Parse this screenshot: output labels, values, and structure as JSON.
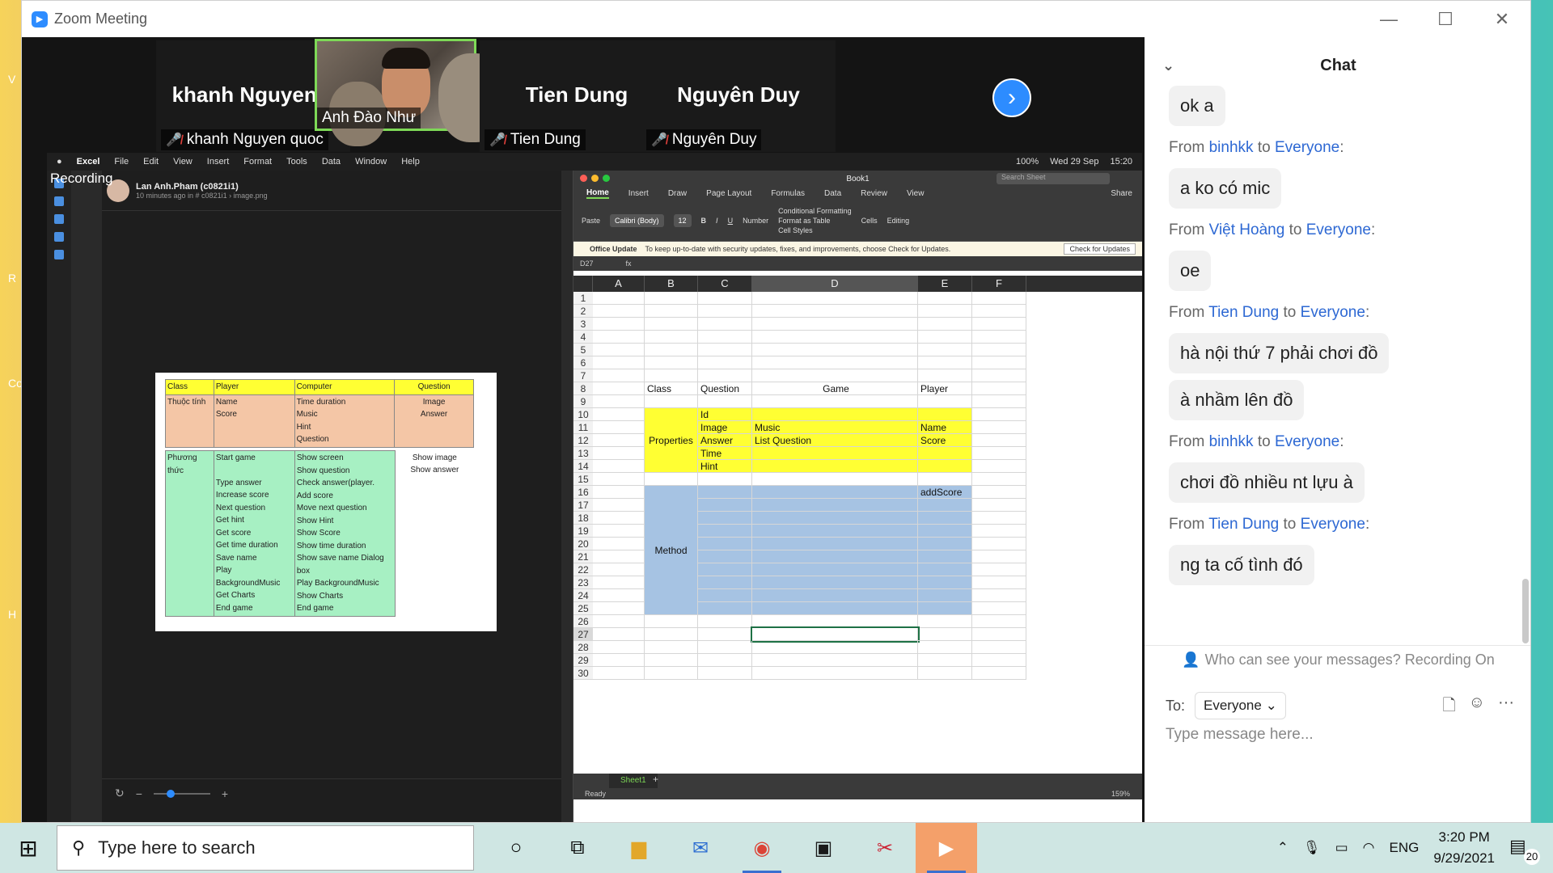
{
  "window": {
    "title": "Zoom Meeting",
    "controls": [
      "—",
      "☐",
      "✕"
    ]
  },
  "participants": [
    {
      "big_name": "khanh  Nguyen...",
      "label": "khanh Nguyen quoc",
      "muted": true,
      "video": false
    },
    {
      "big_name": "",
      "label": "Anh Đào Như",
      "muted": false,
      "video": true
    },
    {
      "big_name": "Tien Dung",
      "label": "Tien Dung",
      "muted": true,
      "video": false
    },
    {
      "big_name": "Nguyên Duy",
      "label": "Nguyên Duy",
      "muted": true,
      "video": false
    }
  ],
  "recording_label": "Recording",
  "mac_menu": [
    "Excel",
    "File",
    "Edit",
    "View",
    "Insert",
    "Format",
    "Tools",
    "Data",
    "Window",
    "Help"
  ],
  "mac_status": [
    "100%",
    "Wed 29 Sep",
    "15:20"
  ],
  "viewer": {
    "user": "Lan Anh.Pham (c0821i1)",
    "meta": "10 minutes ago in # c0821i1 › image.png",
    "footer_user": "c0821i1"
  },
  "image_table": {
    "header": [
      "Class",
      "Player",
      "Computer",
      "Question"
    ],
    "props_label": "Thuộc tính",
    "props_player": [
      "Name",
      "Score"
    ],
    "props_computer": [
      "Time duration",
      "Music",
      "Hint",
      "Question"
    ],
    "props_question": [
      "Image",
      "Answer"
    ],
    "methods_label": "Phương thức",
    "methods_player": [
      "Start game",
      "",
      "Type answer",
      "Increase score",
      "Next question",
      "Get hint",
      "Get score",
      "Get time duration",
      "Save name",
      "Play BackgroundMusic",
      "Get Charts",
      "End game"
    ],
    "methods_computer": [
      "Show screen",
      "Show question",
      "Check answer(player.",
      "Add score",
      "Move next question",
      "Show Hint",
      "Show Score",
      "Show time duration",
      "Show save name Dialog box",
      "Play BackgroundMusic",
      "Show Charts",
      "End game"
    ],
    "methods_question": [
      "Show image",
      "Show answer"
    ]
  },
  "excel": {
    "window_title": "Book1",
    "search_placeholder": "Search Sheet",
    "share": "Share",
    "tabs": [
      "Home",
      "Insert",
      "Draw",
      "Page Layout",
      "Formulas",
      "Data",
      "Review",
      "View"
    ],
    "ribbon": {
      "paste": "Paste",
      "font": "Calibri (Body)",
      "size": "12",
      "number": "Number",
      "cond": "Conditional Formatting",
      "format_table": "Format as Table",
      "cell_styles": "Cell Styles",
      "cells": "Cells",
      "editing": "Editing"
    },
    "update_title": "Office Update",
    "update_text": "To keep up-to-date with security updates, fixes, and improvements, choose Check for Updates.",
    "update_button": "Check for Updates",
    "namebox": "D27",
    "columns": [
      "A",
      "B",
      "C",
      "D",
      "E",
      "F"
    ],
    "rows": [
      "1",
      "2",
      "3",
      "4",
      "5",
      "6",
      "7",
      "8",
      "9",
      "10",
      "11",
      "12",
      "13",
      "14",
      "15",
      "16",
      "17",
      "18",
      "19",
      "20",
      "21",
      "22",
      "23",
      "24",
      "25",
      "26",
      "27",
      "28",
      "29",
      "30"
    ],
    "cells": {
      "B8": "Class",
      "C8": "Question",
      "D8": "Game",
      "E8": "Player",
      "C10": "Id",
      "C11": "Image",
      "D11": "Music",
      "E11": "Name",
      "B12": "Properties",
      "C12": "Answer",
      "D12": "List Question",
      "E12": "Score",
      "C13": "Time",
      "C14": "Hint",
      "E16": "addScore",
      "B21": "Method"
    },
    "sheet_tab": "Sheet1",
    "status": "Ready",
    "zoom": "159%"
  },
  "chat": {
    "title": "Chat",
    "first_message": "ok a",
    "messages": [
      {
        "from": "binhkk",
        "to": "Everyone",
        "texts": [
          "a ko có mic"
        ]
      },
      {
        "from": "Việt Hoàng",
        "to": "Everyone",
        "texts": [
          "oe"
        ]
      },
      {
        "from": "Tien Dung",
        "to": "Everyone",
        "texts": [
          "hà nội thứ 7 phải chơi đồ",
          "à nhầm lên đồ"
        ]
      },
      {
        "from": "binhkk",
        "to": "Everyone",
        "texts": [
          "chơi đồ nhiều nt lựu à"
        ]
      },
      {
        "from": "Tien Dung",
        "to": "Everyone",
        "texts": [
          "ng ta cố tình đó"
        ]
      }
    ],
    "from_word": "From",
    "to_word": "to",
    "privacy": "Who can see your messages? Recording On",
    "to_label": "To:",
    "to_value": "Everyone",
    "placeholder": "Type message here..."
  },
  "taskbar": {
    "search_placeholder": "Type here to search",
    "language": "ENG",
    "time": "3:20 PM",
    "date": "9/29/2021",
    "notifications": "20"
  }
}
